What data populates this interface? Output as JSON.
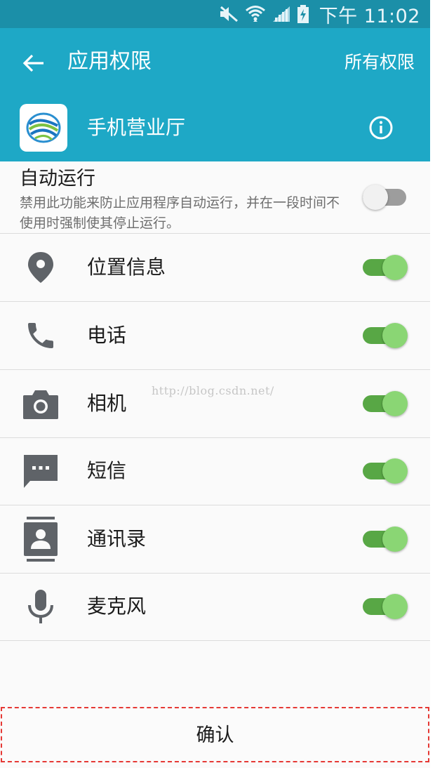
{
  "status_bar": {
    "time": "下午 11:02",
    "icons": [
      "mute-icon",
      "wifi-icon",
      "signal-icon",
      "battery-charging-icon"
    ],
    "background": "#1b8fa8"
  },
  "app_bar": {
    "title": "应用权限",
    "all_permissions_label": "所有权限",
    "background": "#1ea8c6"
  },
  "app": {
    "name": "手机营业厅",
    "icon": "china-mobile-logo",
    "info_icon": "info-icon"
  },
  "auto_run": {
    "title": "自动运行",
    "description": "禁用此功能来防止应用程序自动运行，并在一段时间不使用时强制使其停止运行。",
    "enabled": false
  },
  "permissions": [
    {
      "label": "位置信息",
      "icon": "location-pin-icon",
      "enabled": true
    },
    {
      "label": "电话",
      "icon": "phone-icon",
      "enabled": true
    },
    {
      "label": "相机",
      "icon": "camera-icon",
      "enabled": true
    },
    {
      "label": "短信",
      "icon": "message-icon",
      "enabled": true
    },
    {
      "label": "通讯录",
      "icon": "contacts-icon",
      "enabled": true
    },
    {
      "label": "麦克风",
      "icon": "microphone-icon",
      "enabled": true
    }
  ],
  "watermark": "http://blog.csdn.net/",
  "confirm_label": "确认",
  "colors": {
    "toggle_on_track": "#58a745",
    "toggle_on_knob": "#8ad674",
    "toggle_off_track": "#9d9d9d",
    "icon_gray": "#5f6368"
  }
}
